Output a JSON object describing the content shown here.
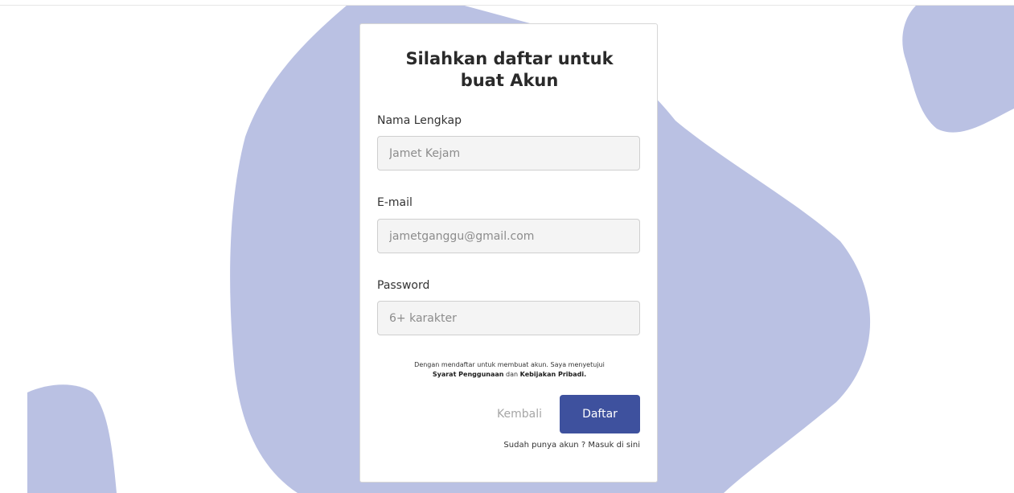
{
  "colors": {
    "blob": "#bac1e3",
    "primary_button": "#3e519e",
    "input_background": "#f4f4f4"
  },
  "form": {
    "title": "Silahkan daftar untuk buat Akun",
    "fields": [
      {
        "label": "Nama Lengkap",
        "placeholder": "Jamet Kejam"
      },
      {
        "label": "E-mail",
        "placeholder": "jametganggu@gmail.com"
      },
      {
        "label": "Password",
        "placeholder": "6+ karakter"
      }
    ],
    "terms": {
      "text": "Dengan mendaftar untuk membuat akun. Saya menyetujui",
      "terms_link": "Syarat Penggunaan",
      "conjunction": "dan",
      "privacy_link": "Kebijakan Pribadi."
    },
    "back_label": "Kembali",
    "submit_label": "Daftar",
    "login_prompt": "Sudah punya akun ?",
    "login_link": "Masuk di sini"
  }
}
